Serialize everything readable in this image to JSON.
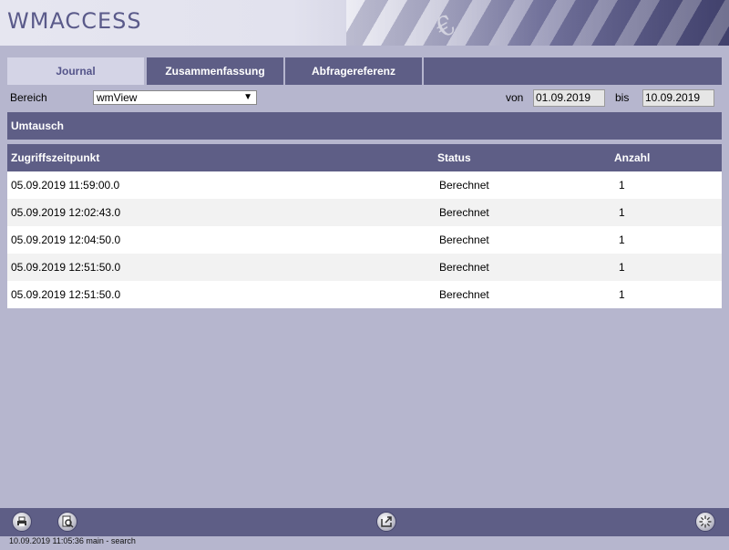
{
  "app": {
    "logo_text": "WMACCESS"
  },
  "tabs": [
    {
      "label": "Journal",
      "active": true
    },
    {
      "label": "Zusammenfassung",
      "active": false
    },
    {
      "label": "Abfragereferenz",
      "active": false
    }
  ],
  "filter": {
    "bereich_label": "Bereich",
    "bereich_value": "wmView",
    "von_label": "von",
    "von_value": "01.09.2019",
    "bis_label": "bis",
    "bis_value": "10.09.2019"
  },
  "section": {
    "title": "Umtausch"
  },
  "table": {
    "columns": [
      "Zugriffszeitpunkt",
      "Status",
      "Anzahl"
    ],
    "rows": [
      [
        "05.09.2019 11:59:00.0",
        "Berechnet",
        "1"
      ],
      [
        "05.09.2019 12:02:43.0",
        "Berechnet",
        "1"
      ],
      [
        "05.09.2019 12:04:50.0",
        "Berechnet",
        "1"
      ],
      [
        "05.09.2019 12:51:50.0",
        "Berechnet",
        "1"
      ],
      [
        "05.09.2019 12:51:50.0",
        "Berechnet",
        "1"
      ]
    ]
  },
  "footer": {
    "buttons": [
      "print-icon",
      "preview-icon",
      "export-icon",
      "loading-spinner-icon"
    ],
    "status_text": "10.09.2019 11:05:36 main - search"
  },
  "colors": {
    "background": "#b6b6ce",
    "bar": "#5e5e86",
    "active_tab": "#d4d4e6",
    "logo": "#5a5a8a"
  }
}
